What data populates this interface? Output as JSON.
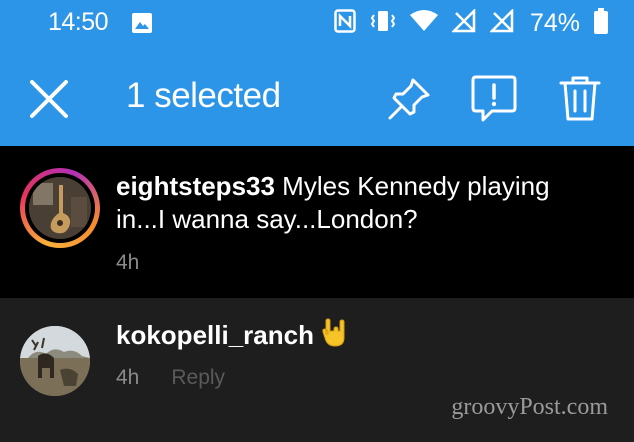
{
  "status_bar": {
    "time": "14:50",
    "battery": "74%",
    "icons": [
      "image-icon",
      "nfc-icon",
      "vibrate-icon",
      "wifi-icon",
      "signal-icon",
      "signal-icon",
      "battery-icon"
    ]
  },
  "action_bar": {
    "title": "1 selected",
    "background_color": "#2d95e8",
    "icons": [
      "close-icon",
      "pin-icon",
      "report-icon",
      "trash-icon"
    ]
  },
  "comments": [
    {
      "username": "eightsteps33",
      "text": " Myles Kennedy playing in...I wanna say...London?",
      "time": "4h"
    },
    {
      "username": "kokopelli_ranch",
      "emoji": "rock-on-hand-icon",
      "time": "4h",
      "reply_label": "Reply"
    }
  ],
  "watermark": "groovyPost.com"
}
